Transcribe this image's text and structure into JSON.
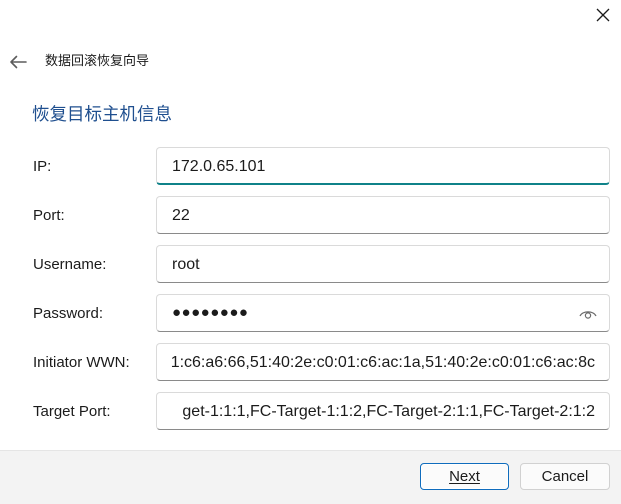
{
  "window": {
    "wizard_title": "数据回滚恢复向导",
    "section_title": "恢复目标主机信息"
  },
  "form": {
    "ip": {
      "label": "IP:",
      "value": "172.0.65.101"
    },
    "port": {
      "label": "Port:",
      "value": "22"
    },
    "username": {
      "label": "Username:",
      "value": "root"
    },
    "password": {
      "label": "Password:",
      "value": "●●●●●●●●"
    },
    "initiator_wwn": {
      "label": "Initiator WWN:",
      "value": "1:c6:a6:66,51:40:2e:c0:01:c6:ac:1a,51:40:2e:c0:01:c6:ac:8c"
    },
    "target_port": {
      "label": "Target Port:",
      "value": "get-1:1:1,FC-Target-1:1:2,FC-Target-2:1:1,FC-Target-2:1:2"
    }
  },
  "footer": {
    "next_label": "Next",
    "cancel_label": "Cancel"
  },
  "colors": {
    "section_title": "#1f4f8f",
    "focus_accent": "#0f8289",
    "primary_border": "#0f6cbd",
    "footer_bg": "#f3f3f3"
  },
  "icons": {
    "close": "close-icon",
    "back": "back-arrow-icon",
    "reveal_password": "eye-icon"
  }
}
